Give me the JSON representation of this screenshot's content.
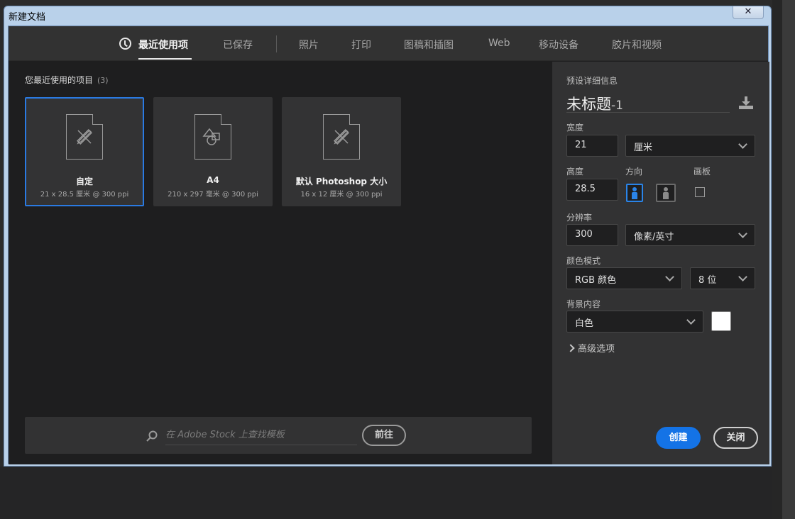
{
  "window": {
    "title": "新建文档",
    "close_glyph": "✕"
  },
  "tabs": [
    {
      "label": "最近使用项",
      "active": true
    },
    {
      "label": "已保存"
    },
    {
      "label": "照片"
    },
    {
      "label": "打印"
    },
    {
      "label": "图稿和插图"
    },
    {
      "label": "Web"
    },
    {
      "label": "移动设备"
    },
    {
      "label": "胶片和视频"
    }
  ],
  "recent": {
    "heading": "您最近使用的项目",
    "count": "(3)",
    "items": [
      {
        "name": "自定",
        "spec": "21 x 28.5 厘米 @ 300 ppi",
        "icon": "pencil-ruler-icon",
        "selected": true
      },
      {
        "name": "A4",
        "spec": "210 x 297 毫米 @ 300 ppi",
        "icon": "shapes-icon"
      },
      {
        "name": "默认 Photoshop 大小",
        "spec": "16 x 12 厘米 @ 300 ppi",
        "icon": "pencil-ruler-icon"
      }
    ]
  },
  "stock": {
    "placeholder": "在 Adobe Stock 上查找模板",
    "go_label": "前往"
  },
  "preset": {
    "section_label": "预设详细信息",
    "doc_name": "未标题",
    "doc_name_suffix": "-1",
    "width_label": "宽度",
    "width_value": "21",
    "width_unit": "厘米",
    "height_label": "高度",
    "height_value": "28.5",
    "orientation_label": "方向",
    "artboard_label": "画板",
    "resolution_label": "分辨率",
    "resolution_value": "300",
    "resolution_unit": "像素/英寸",
    "color_mode_label": "颜色模式",
    "color_mode_value": "RGB 颜色",
    "bit_depth_value": "8 位",
    "background_label": "背景内容",
    "background_value": "白色",
    "background_color": "#ffffff",
    "advanced_label": "高级选项"
  },
  "actions": {
    "create_label": "创建",
    "close_label": "关闭"
  },
  "colors": {
    "accent": "#1473e6",
    "selected_border": "#2a7ae2"
  }
}
